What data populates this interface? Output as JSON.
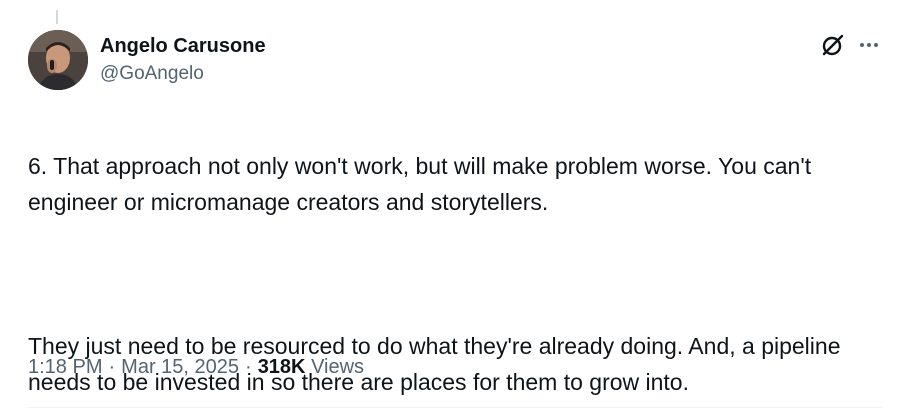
{
  "author": {
    "display_name": "Angelo Carusone",
    "handle": "@GoAngelo",
    "avatar_icon": "avatar-photo"
  },
  "actions": {
    "grok_icon": "grok-icon",
    "more_icon": "more-icon"
  },
  "tweet": {
    "paragraph_1": "6. That approach not only won't work, but will make problem worse. You can't engineer or micromanage creators and storytellers.",
    "paragraph_2": "They just need to be resourced to do what they're already doing. And, a pipeline needs to be invested in so there are places for them to grow into."
  },
  "meta": {
    "time": "1:18 PM",
    "date": "Mar 15, 2025",
    "separator": "·",
    "views_count": "318K",
    "views_label": "Views"
  },
  "colors": {
    "text_primary": "#0f1419",
    "text_secondary": "#536471",
    "divider": "#eff3f4"
  }
}
